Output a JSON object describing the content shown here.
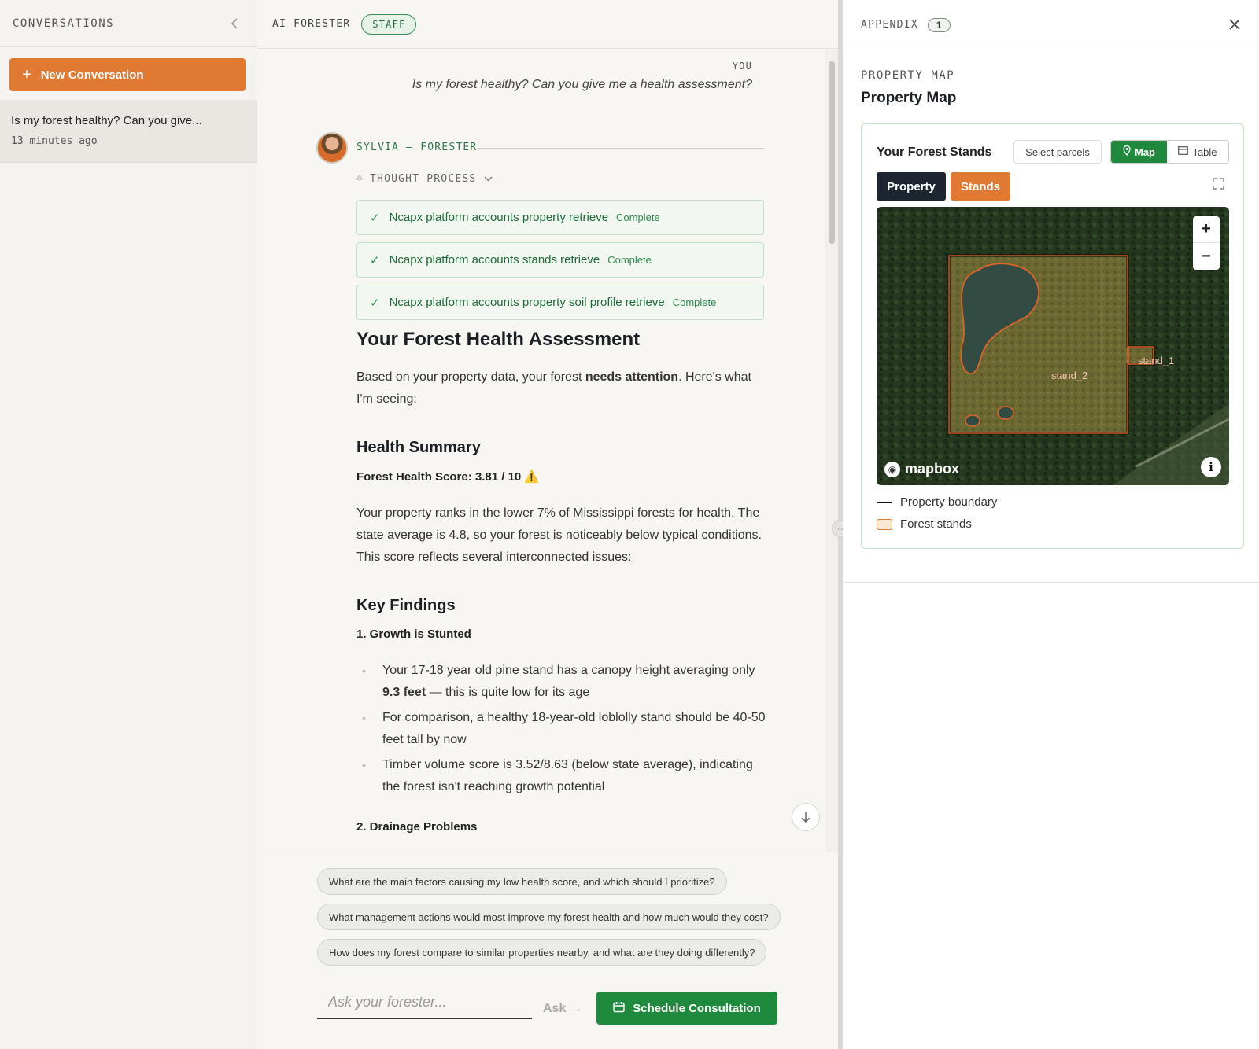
{
  "sidebar": {
    "title": "CONVERSATIONS",
    "new_conversation": "New Conversation",
    "conversations": [
      {
        "title": "Is my forest healthy? Can you give...",
        "time": "13 minutes ago"
      }
    ]
  },
  "header": {
    "brand": "AI FORESTER",
    "badge": "STAFF"
  },
  "chat": {
    "user_label": "YOU",
    "user_message": "Is my forest healthy? Can you give me a health assessment?",
    "agent_label": "SYLVIA — FORESTER",
    "thought_process": "THOUGHT PROCESS",
    "tools": [
      {
        "name": "Ncapx platform accounts property retrieve",
        "status": "Complete"
      },
      {
        "name": "Ncapx platform accounts stands retrieve",
        "status": "Complete"
      },
      {
        "name": "Ncapx platform accounts property soil profile retrieve",
        "status": "Complete"
      }
    ],
    "heading": "Your Forest Health Assessment",
    "intro_before": "Based on your property data, your forest ",
    "intro_bold": "needs attention",
    "intro_after": ". Here's what I'm seeing:",
    "health_summary_title": "Health Summary",
    "score_text": "Forest Health Score: 3.81 / 10 ⚠️",
    "summary_paragraph": "Your property ranks in the lower 7% of Mississippi forests for health. The state average is 4.8, so your forest is noticeably below typical conditions. This score reflects several interconnected issues:",
    "key_findings_title": "Key Findings",
    "finding_1_title": "1. Growth is Stunted",
    "bullets": [
      {
        "before": "Your 17-18 year old pine stand has a canopy height averaging only ",
        "bold": "9.3 feet",
        "after": " — this is quite low for its age"
      },
      {
        "before": "For comparison, a healthy 18-year-old loblolly stand should be 40-50 feet tall by now",
        "bold": "",
        "after": ""
      },
      {
        "before": "Timber volume score is 3.52/8.63 (below state average), indicating the forest isn't reaching growth potential",
        "bold": "",
        "after": ""
      }
    ],
    "finding_2_title": "2. Drainage Problems"
  },
  "composer": {
    "suggestions": [
      "What are the main factors causing my low health score, and which should I prioritize?",
      "What management actions would most improve my forest health and how much would they cost?",
      "How does my forest compare to similar properties nearby, and what are they doing differently?"
    ],
    "placeholder": "Ask your forester...",
    "ask_label": "Ask →",
    "schedule_label": "Schedule Consultation"
  },
  "appendix": {
    "title": "APPENDIX",
    "count": "1",
    "section_label": "PROPERTY MAP",
    "section_title": "Property Map",
    "card_title": "Your Forest Stands",
    "select_parcels": "Select parcels",
    "map_label": "Map",
    "table_label": "Table",
    "property_btn": "Property",
    "stands_btn": "Stands",
    "map": {
      "stand_labels": [
        "stand_2",
        "stand_1"
      ],
      "attribution": "mapbox",
      "info": "i"
    },
    "legend": [
      {
        "label": "Property boundary"
      },
      {
        "label": "Forest stands"
      }
    ]
  },
  "colors": {
    "accent_orange": "#e07a33",
    "accent_green": "#1f8a3e",
    "dark_navy": "#1d2530"
  }
}
